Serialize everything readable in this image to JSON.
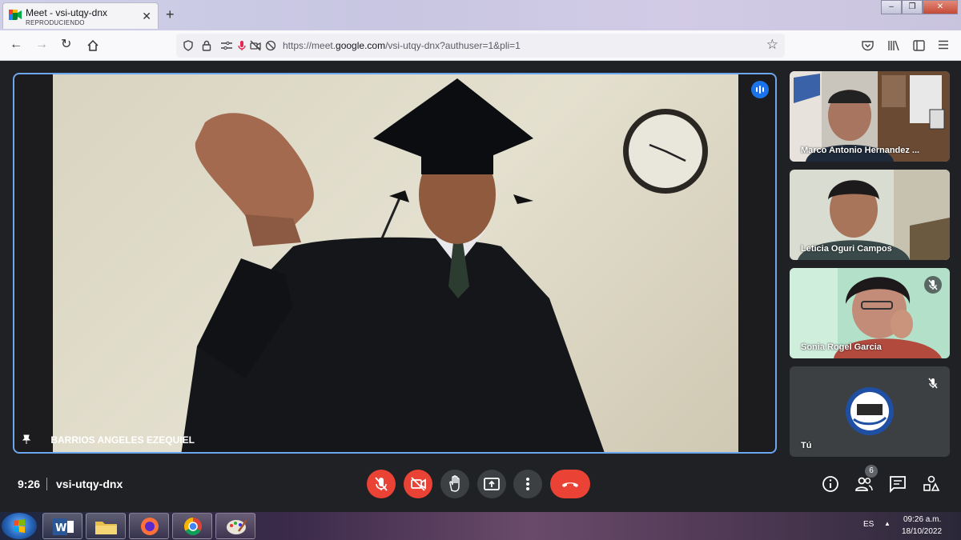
{
  "browser": {
    "tab": {
      "title": "Meet - vsi-utqy-dnx",
      "subtitle": "REPRODUCIENDO"
    },
    "new_tab": "+",
    "url": {
      "prefix": "https://meet.",
      "domain": "google.com",
      "path": "/vsi-utqy-dnx?authuser=1&pli=1"
    }
  },
  "meet": {
    "main_speaker": {
      "name": "BARRIOS ANGELES EZEQUIEL"
    },
    "participants": [
      {
        "name": "Marco Antonio Hernandez ...",
        "muted": false
      },
      {
        "name": "Leticia Oguri Campos",
        "muted": false
      },
      {
        "name": "Sonia Rogel Garcia",
        "muted": true
      },
      {
        "name": "Tú",
        "muted": true
      }
    ],
    "time": "9:26",
    "meeting_code": "vsi-utqy-dnx",
    "people_count": "6"
  },
  "taskbar": {
    "language": "ES",
    "clock_time": "09:26 a.m.",
    "clock_date": "18/10/2022"
  },
  "colors": {
    "accent_blue": "#1a73e8",
    "highlight_border": "#6ba6ee",
    "danger_red": "#ea4335",
    "meet_background": "#202124"
  }
}
